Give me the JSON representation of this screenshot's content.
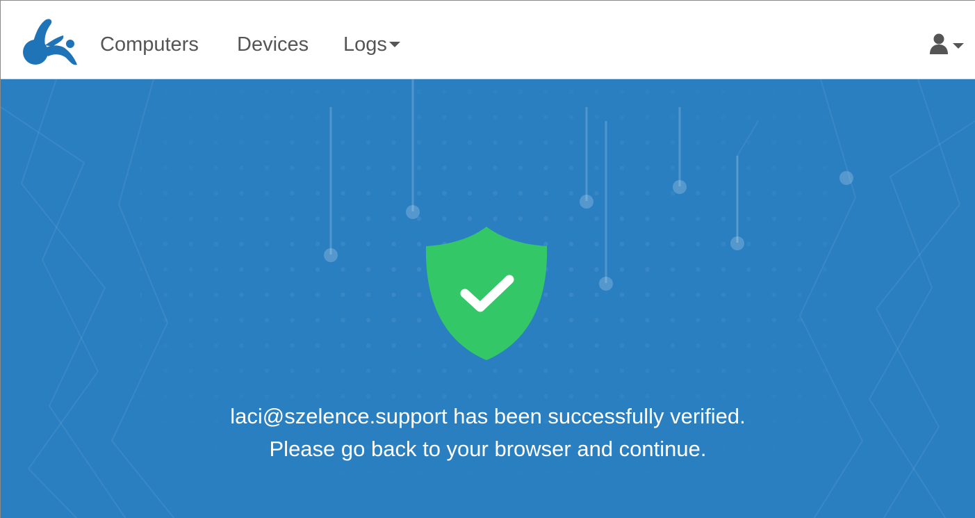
{
  "navbar": {
    "logo_icon": "splashtop-logo-icon",
    "items": [
      {
        "label": "Computers"
      },
      {
        "label": "Devices"
      },
      {
        "label": "Logs",
        "has_dropdown": true
      }
    ],
    "user_icon": "user-icon"
  },
  "verification": {
    "icon": "shield-check-icon",
    "line1": "laci@szelence.support has been successfully verified.",
    "line2": "Please go back to your browser and continue."
  },
  "colors": {
    "hero_bg": "#2a7fc1",
    "brand_blue": "#1f73b7",
    "shield_green": "#34c768",
    "nav_text": "#555555"
  }
}
